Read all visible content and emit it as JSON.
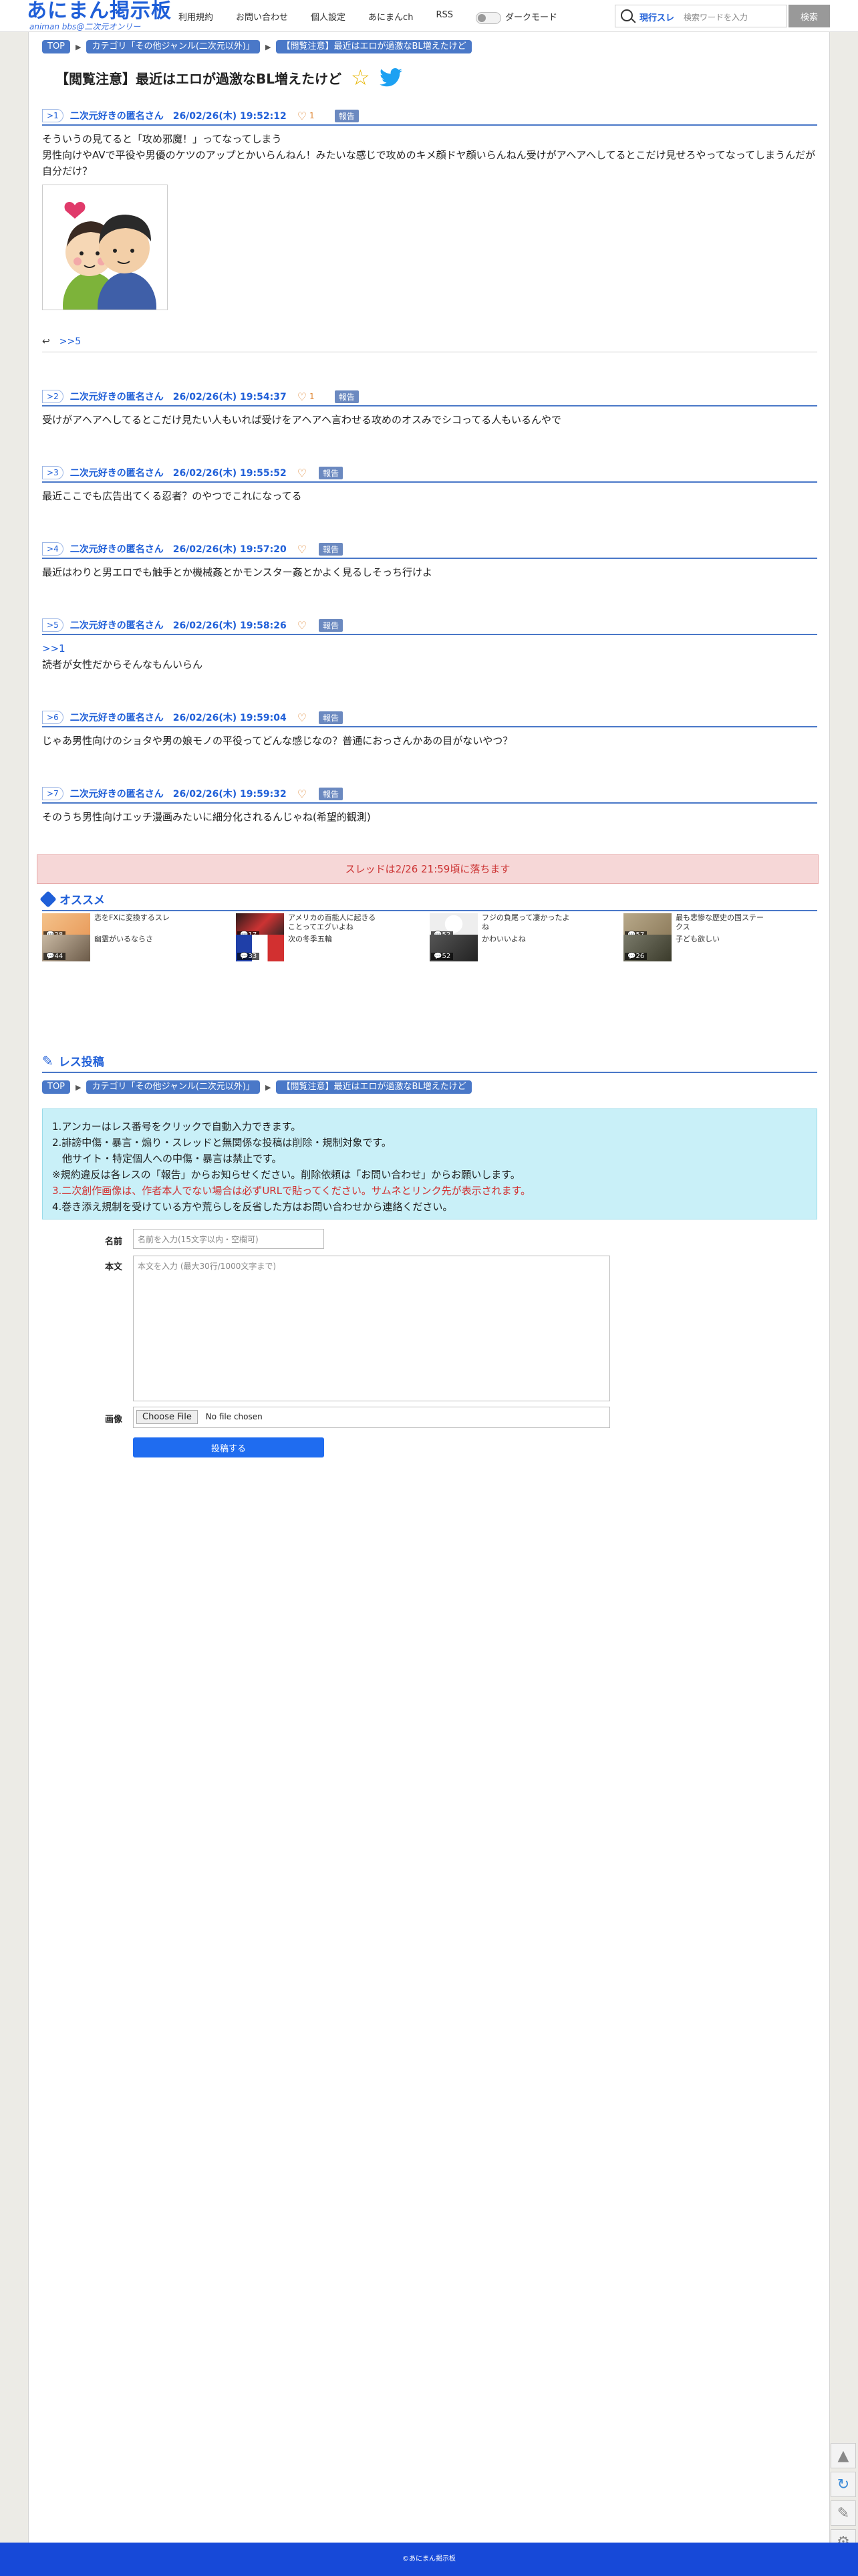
{
  "header": {
    "logo": "あにまん掲示板",
    "logo_sub": "animan bbs@二次元オンリー",
    "nav": [
      "利用規約",
      "お問い合わせ",
      "個人設定",
      "あにまんch",
      "RSS"
    ],
    "darkmode_label": "ダークモード",
    "search_scope": "現行スレ",
    "search_placeholder": "検索ワードを入力",
    "search_button": "検索"
  },
  "breadcrumb": [
    "TOP",
    "カテゴリ「その他ジャンル(二次元以外)」",
    "【閲覧注意】最近はエロが過激なBL増えたけど"
  ],
  "thread": {
    "title": "【閲覧注意】最近はエロが過激なBL増えたけど"
  },
  "posts": [
    {
      "num": "1",
      "name": "二次元好きの匿名さん",
      "date": "26/02/26(木) 19:52:12",
      "likes": "1",
      "report": "報告",
      "text": "そういうの見てると「攻め邪魔！」ってなってしまう\n男性向けやAVで平役や男優のケツのアップとかいらんねん！みたいな感じで攻めのキメ顔ドヤ顔いらんねん受けがアヘアヘしてるとこだけ見せろやってなってしまうんだが自分だけ？",
      "reply_link": ">>5"
    },
    {
      "num": "2",
      "name": "二次元好きの匿名さん",
      "date": "26/02/26(木) 19:54:37",
      "likes": "1",
      "report": "報告",
      "text": "受けがアヘアヘしてるとこだけ見たい人もいれば受けをアヘアヘ言わせる攻めのオスみでシコってる人もいるんやで"
    },
    {
      "num": "3",
      "name": "二次元好きの匿名さん",
      "date": "26/02/26(木) 19:55:52",
      "likes": "",
      "report": "報告",
      "text": "最近ここでも広告出てくる忍者？のやつでこれになってる"
    },
    {
      "num": "4",
      "name": "二次元好きの匿名さん",
      "date": "26/02/26(木) 19:57:20",
      "likes": "",
      "report": "報告",
      "text": "最近はわりと男エロでも触手とか機械姦とかモンスター姦とかよく見るしそっち行けよ"
    },
    {
      "num": "5",
      "name": "二次元好きの匿名さん",
      "date": "26/02/26(木) 19:58:26",
      "likes": "",
      "report": "報告",
      "anchor": ">>1",
      "text": "読者が女性だからそんなもんいらん"
    },
    {
      "num": "6",
      "name": "二次元好きの匿名さん",
      "date": "26/02/26(木) 19:59:04",
      "likes": "",
      "report": "報告",
      "text": "じゃあ男性向けのショタや男の娘モノの平役ってどんな感じなの？普通におっさんかあの目がないやつ？"
    },
    {
      "num": "7",
      "name": "二次元好きの匿名さん",
      "date": "26/02/26(木) 19:59:32",
      "likes": "",
      "report": "報告",
      "text": "そのうち男性向けエッチ漫画みたいに細分化されるんじゃね(希望的観測)"
    }
  ],
  "notice": "スレッドは2/26 21:59頃に落ちます",
  "recommend": {
    "title": "オススメ",
    "items": [
      {
        "title": "恋をFXに変換するスレ",
        "count": "28"
      },
      {
        "title": "アメリカの百能人に起きることってエグいよね",
        "count": "17"
      },
      {
        "title": "フジの負尾って凄かったよね",
        "count": "52"
      },
      {
        "title": "最も悲惨な歴史の国ステークス",
        "count": "57"
      },
      {
        "title": "幽霊がいるならさ",
        "count": "44"
      },
      {
        "title": "次の冬季五輪",
        "count": "33"
      },
      {
        "title": "かわいいよね",
        "count": "52"
      },
      {
        "title": "子ども欲しい",
        "count": "26"
      }
    ]
  },
  "form": {
    "title": "レス投稿",
    "guide": [
      "1.アンカーはレス番号をクリックで自動入力できます。",
      "2.誹謗中傷・暴言・煽り・スレッドと無関係な投稿は削除・規制対象です。",
      "　他サイト・特定個人への中傷・暴言は禁止です。",
      "※規約違反は各レスの「報告」からお知らせください。削除依頼は「お問い合わせ」からお願いします。",
      "3.二次創作画像は、作者本人でない場合は必ずURLで貼ってください。サムネとリンク先が表示されます。",
      "4.巻き添え規制を受けている方や荒らしを反省した方はお問い合わせから連絡ください。"
    ],
    "name_label": "名前",
    "name_placeholder": "名前を入力(15文字以内・空欄可)",
    "body_label": "本文",
    "body_placeholder": "本文を入力 (最大30行/1000文字まで)",
    "image_label": "画像",
    "file_button": "Choose File",
    "file_status": "No file chosen",
    "submit": "投稿する"
  },
  "footer": "©あにまん掲示板",
  "colors": {
    "brand": "#1f5fd8",
    "accent_bar": "#4a78c8",
    "footer": "#1749d8"
  }
}
